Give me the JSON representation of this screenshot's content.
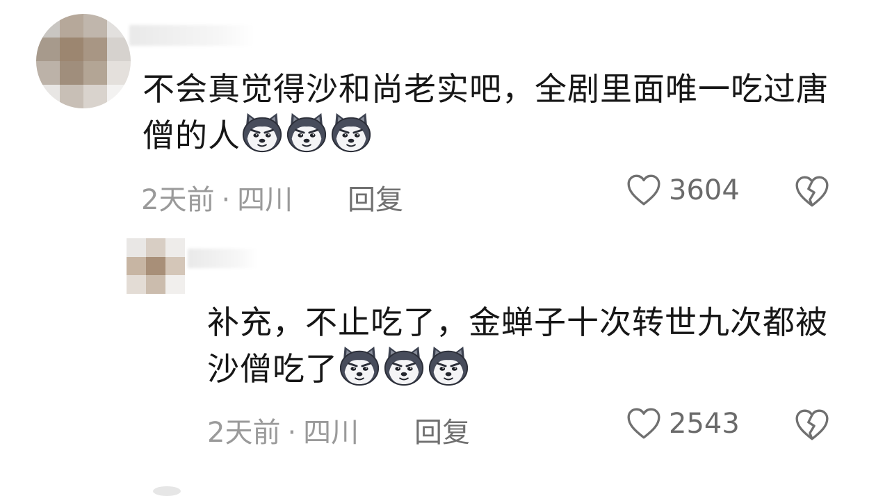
{
  "comments": [
    {
      "text": "不会真觉得沙和尚老实吧，全剧里面唯一吃过唐僧的人",
      "emoji": [
        "husky-emoji",
        "husky-emoji",
        "husky-emoji"
      ],
      "time": "2天前",
      "location": "四川",
      "reply_label": "回复",
      "likes": "3604"
    },
    {
      "text": "补充，不止吃了，金蝉子十次转世九次都被沙僧吃了",
      "emoji": [
        "husky-emoji",
        "husky-emoji",
        "husky-emoji"
      ],
      "time": "2天前",
      "location": "四川",
      "reply_label": "回复",
      "likes": "2543"
    }
  ],
  "separator": "·",
  "colors": {
    "text": "#161616",
    "meta": "#9a9a9a",
    "icon": "#707070"
  }
}
